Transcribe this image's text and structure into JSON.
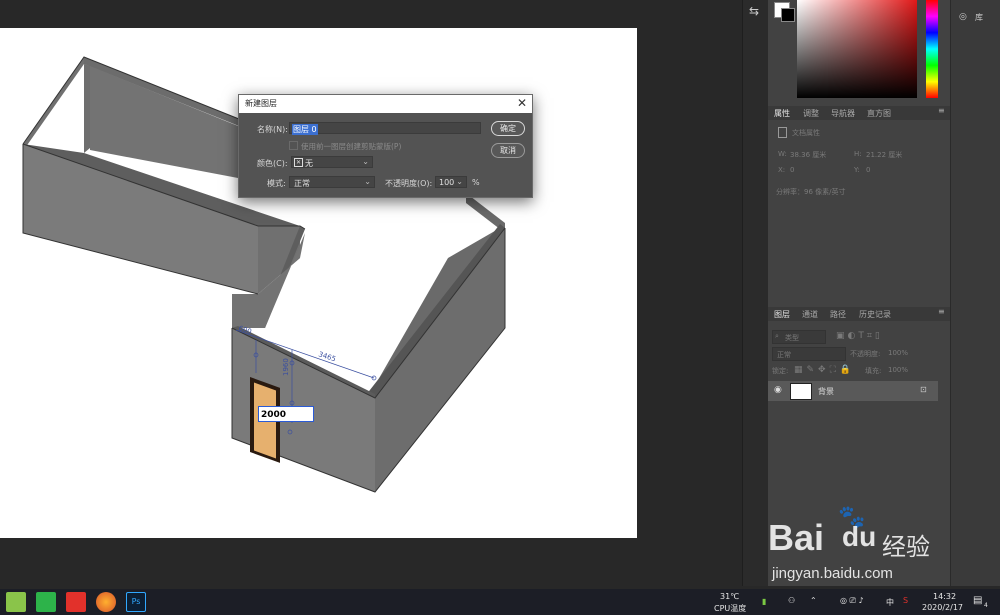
{
  "dialog": {
    "title": "新建图层",
    "close_glyph": "✕",
    "name_label": "名称(N):",
    "name_value": "图层 0",
    "clipping_checkbox_label": "使用前一图层创建剪贴蒙版(P)",
    "color_label": "颜色(C):",
    "color_value": "无",
    "mode_label": "模式:",
    "mode_value": "正常",
    "opacity_label": "不透明度(O):",
    "opacity_value": "100",
    "opacity_unit": "%",
    "ok_label": "确定",
    "cancel_label": "取消"
  },
  "canvas": {
    "dimension_input_value": "2000",
    "dim_top_left": "600",
    "dim_vertical": "1960",
    "dim_right": "3465",
    "door_color": "#e6b06e"
  },
  "properties_panel": {
    "tabs": [
      "属性",
      "调整",
      "导航器",
      "直方图"
    ],
    "doc_label": "文档属性",
    "w_label": "W:",
    "w_value": "38.36 厘米",
    "h_label": "H:",
    "h_value": "21.22 厘米",
    "x_label": "X:",
    "x_value": "0",
    "y_label": "Y:",
    "y_value": "0",
    "resolution_label": "分辨率：96 像素/英寸"
  },
  "layers_panel": {
    "tabs": [
      "图层",
      "通道",
      "路径",
      "历史记录"
    ],
    "filter_label": "类型",
    "blend_mode": "正常",
    "opacity_label": "不透明度:",
    "opacity_value": "100%",
    "lock_label": "锁定:",
    "fill_label": "填充:",
    "fill_value": "100%",
    "layer_name": "背景"
  },
  "libraries": {
    "label": "库"
  },
  "taskbar": {
    "temp_value": "31℃",
    "temp_label": "CPU温度",
    "ime_label": "中",
    "time": "14:32",
    "date": "2020/2/17",
    "notification_count": "4"
  },
  "watermark": {
    "brand": "Bai",
    "brand_du": "du",
    "jingyan": "经验",
    "url": "jingyan.baidu.com"
  }
}
